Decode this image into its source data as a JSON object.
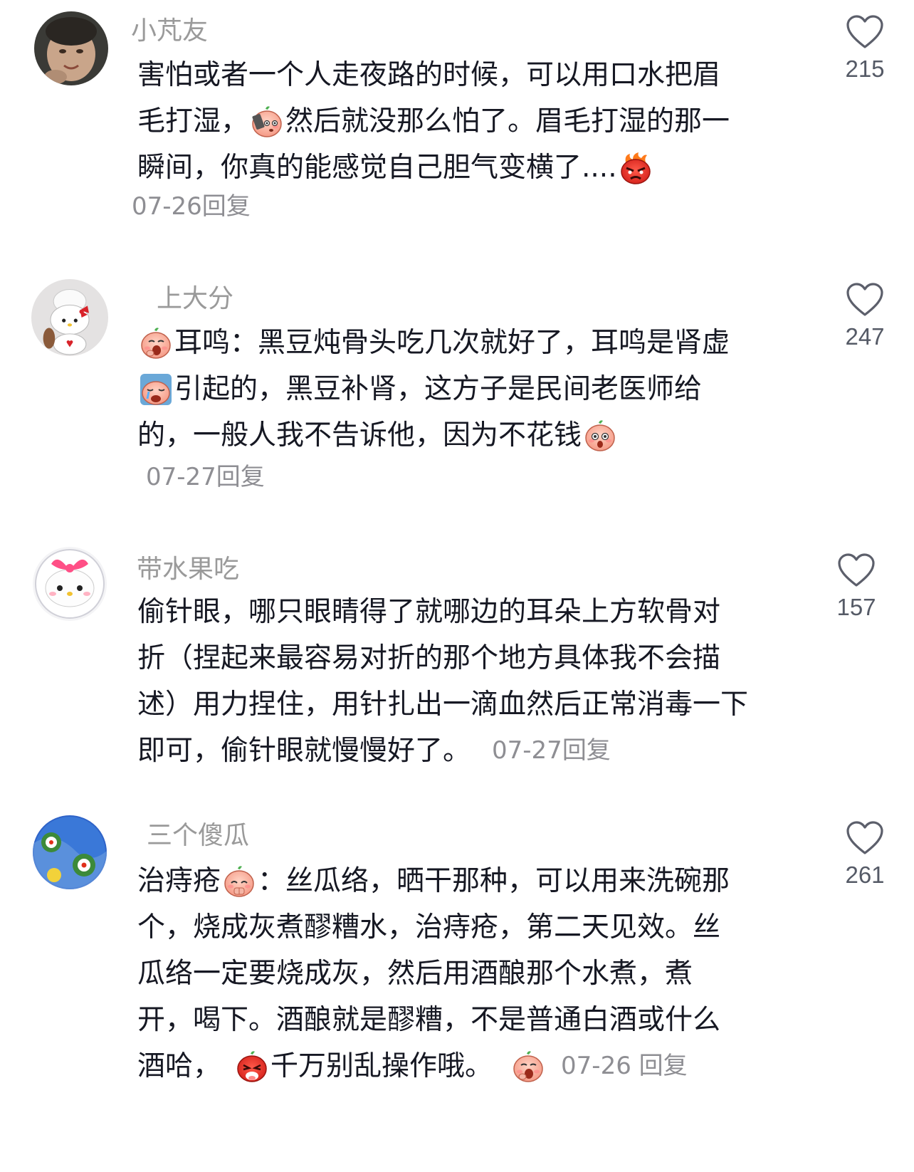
{
  "comments": [
    {
      "username": "小芃友",
      "lines": [
        [
          "害怕或者一个人走夜路的时候，可以用口水把眉"
        ],
        [
          "毛打湿，",
          "然后就没那么怕了。眉毛打湿的那一"
        ],
        [
          "瞬间，你真的能感觉自己胆气变横了...."
        ]
      ],
      "date": "07-26",
      "reply_label": "回复",
      "likes": "215"
    },
    {
      "username": "上大分",
      "lines": [
        [
          "耳鸣：黑豆炖骨头吃几次就好了，耳鸣是肾虚"
        ],
        [
          "引起的，黑豆补肾，这方子是民间老医师给"
        ],
        [
          "的，一般人我不告诉他，因为不花钱"
        ]
      ],
      "date": "07-27",
      "reply_label": "回复",
      "likes": "247"
    },
    {
      "username": "带水果吃",
      "lines": [
        [
          "偷针眼，哪只眼睛得了就哪边的耳朵上方软骨对"
        ],
        [
          "折（捏起来最容易对折的那个地方具体我不会描"
        ],
        [
          "述）用力捏住，用针扎出一滴血然后正常消毒一下"
        ],
        [
          "即可，偷针眼就慢慢好了。"
        ]
      ],
      "date": "07-27",
      "reply_label": "回复",
      "likes": "157"
    },
    {
      "username": "三个傻瓜",
      "lines": [
        [
          "治痔疮",
          "：丝瓜络，晒干那种，可以用来洗碗那"
        ],
        [
          "个，烧成灰煮醪糟水，治痔疮，第二天见效。丝"
        ],
        [
          "瓜络一定要烧成灰，然后用酒酿那个水煮，煮"
        ],
        [
          "开，喝下。酒酿就是醪糟，不是普通白酒或什么"
        ],
        [
          "酒哈，",
          "千万别乱操作哦。"
        ]
      ],
      "date": "07-26",
      "reply_label": "回复",
      "likes": "261"
    }
  ],
  "icons": {
    "like": "heart-outline-icon",
    "emojis": [
      "phone-face-emoji",
      "angry-flame-emoji",
      "yawn-emoji",
      "crying-emoji",
      "surprised-emoji",
      "pleading-emoji",
      "tongue-out-emoji",
      "yawn-emoji"
    ]
  },
  "colors": {
    "text": "#161823",
    "username": "#9a9a9a",
    "meta": "#8e8e93"
  }
}
